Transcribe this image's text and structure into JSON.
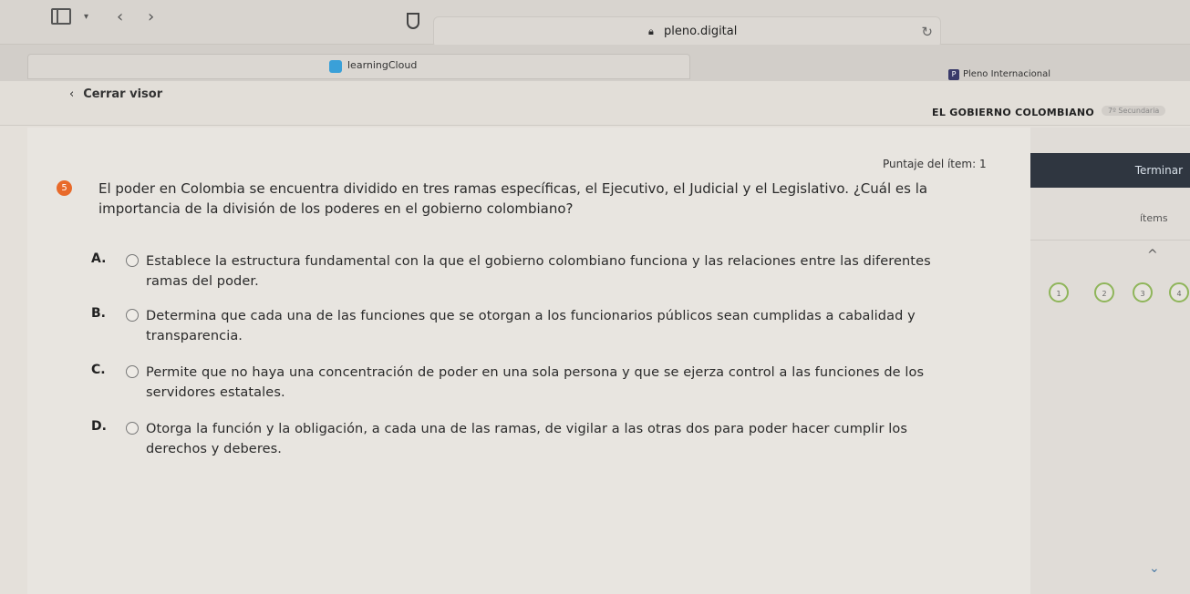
{
  "browser": {
    "url": "pleno.digital",
    "tabs": [
      {
        "label": "learningCloud"
      },
      {
        "label": "Pleno Internacional",
        "favicon_letter": "P"
      }
    ]
  },
  "viewer": {
    "close_label": "Cerrar visor",
    "doc_title": "EL GOBIERNO COLOMBIANO",
    "grade_badge": "7º Secundaria"
  },
  "question": {
    "number": "5",
    "score_label": "Puntaje del ítem: 1",
    "text": "El poder en Colombia se encuentra dividido en tres ramas específicas, el Ejecutivo, el Judicial y el Legislativo. ¿Cuál es la importancia de la división de los poderes en el gobierno colombiano?",
    "options": [
      {
        "letter": "A.",
        "text": "Establece la estructura fundamental con la que el gobierno colombiano funciona y las relaciones entre las diferentes ramas del poder."
      },
      {
        "letter": "B.",
        "text": "Determina que cada una de las funciones que se otorgan a los funcionarios públicos sean cumplidas a cabalidad y transparencia."
      },
      {
        "letter": "C.",
        "text": "Permite que no haya una concentración de poder en una sola persona y que se ejerza control a las funciones de los servidores estatales."
      },
      {
        "letter": "D.",
        "text": "Otorga la función y la obligación, a cada una de las ramas, de vigilar a las otras dos para poder hacer cumplir los derechos y deberes."
      }
    ]
  },
  "side_panel": {
    "finish_label": "Terminar",
    "items_label": "ítems",
    "items": [
      "1",
      "2",
      "3",
      "4"
    ]
  },
  "colors": {
    "question_badge": "#e86a2a",
    "finish_button": "#2f3640",
    "item_ring": "#8fb55a"
  }
}
